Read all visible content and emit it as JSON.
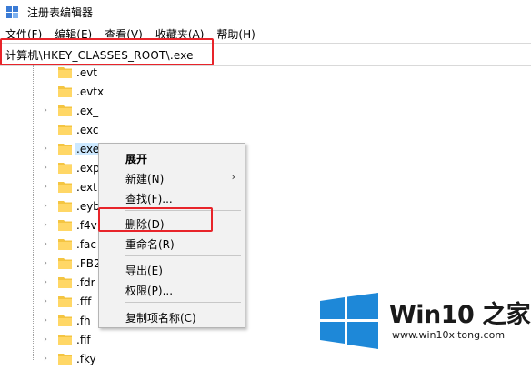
{
  "window": {
    "title": "注册表编辑器"
  },
  "menubar": {
    "items": [
      "文件(F)",
      "编辑(E)",
      "查看(V)",
      "收藏夹(A)",
      "帮助(H)"
    ]
  },
  "address": {
    "path": "计算机\\HKEY_CLASSES_ROOT\\.exe"
  },
  "tree": {
    "rows": [
      {
        "label": ".evt",
        "expandable": false
      },
      {
        "label": ".evtx",
        "expandable": false
      },
      {
        "label": ".ex_",
        "expandable": true
      },
      {
        "label": ".exc",
        "expandable": false
      },
      {
        "label": ".exe",
        "expandable": true,
        "selected": true
      },
      {
        "label": ".exp",
        "expandable": true
      },
      {
        "label": ".ext",
        "expandable": true
      },
      {
        "label": ".eyb",
        "expandable": true
      },
      {
        "label": ".f4v",
        "expandable": true
      },
      {
        "label": ".fac",
        "expandable": true
      },
      {
        "label": ".FB2",
        "expandable": true
      },
      {
        "label": ".fdr",
        "expandable": true
      },
      {
        "label": ".fff",
        "expandable": true
      },
      {
        "label": ".fh",
        "expandable": true
      },
      {
        "label": ".fif",
        "expandable": true
      },
      {
        "label": ".fky",
        "expandable": true
      }
    ]
  },
  "context_menu": {
    "expand": "展开",
    "new": "新建(N)",
    "find": "查找(F)...",
    "delete": "删除(D)",
    "rename": "重命名(R)",
    "export": "导出(E)",
    "permissions": "权限(P)...",
    "copy_key_name": "复制项名称(C)"
  },
  "watermark": {
    "title": "Win10 之家",
    "url": "www.win10xitong.com",
    "color": "#1e88d8"
  },
  "colors": {
    "highlight": "#e8242a",
    "folder": "#f4c542",
    "selected": "#cce8ff"
  }
}
